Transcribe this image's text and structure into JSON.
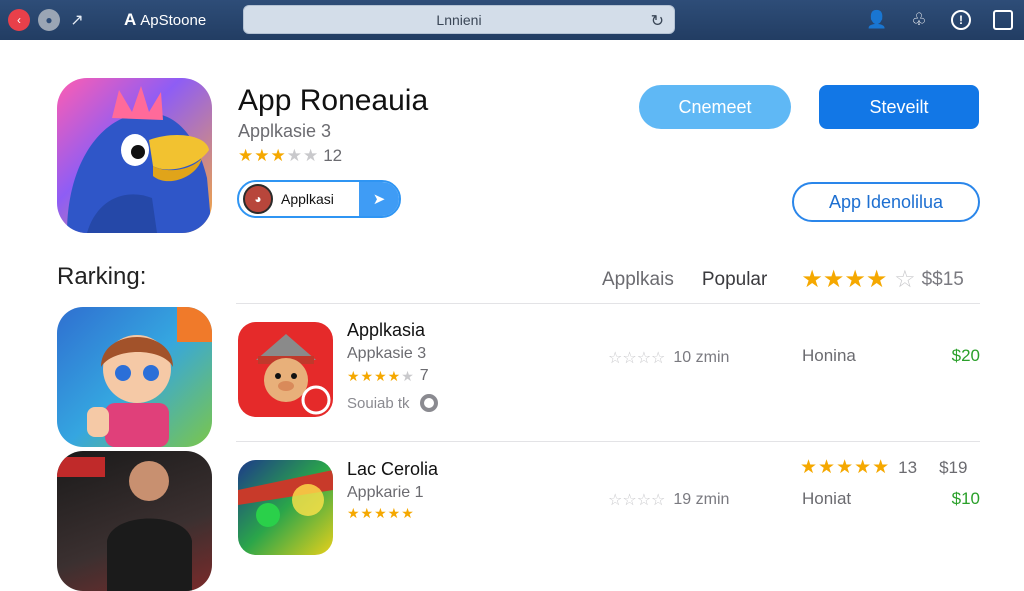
{
  "window": {
    "app_name": "ApStoone",
    "search_value": "Lnnieni"
  },
  "hero": {
    "title": "App Roneauia",
    "subtitle": "Applkasie 3",
    "rating_stars": 3,
    "rating_count": "12",
    "pill_label": "Applkasi",
    "buttons": {
      "primary_light": "Cnemeet",
      "primary": "Steveilt",
      "outline": "App Idenolilua"
    }
  },
  "ranking": {
    "title": "Rarking",
    "tabs": [
      "Applkais",
      "Popular"
    ],
    "header_stars": 4,
    "header_price": "$$15"
  },
  "items": [
    {
      "title": "Applkasia",
      "subtitle": "Appkasie 3",
      "stars": 4,
      "rating_count": "7",
      "extra": "Souiab tk",
      "meta_stars": 0,
      "meta_value": "10 zmin",
      "category": "Honina",
      "price": "$20"
    },
    {
      "title": "Lac Cerolia",
      "subtitle": "Appkarie 1",
      "stars": 5,
      "rating_count": "13",
      "top_price": "$19",
      "meta_stars": 0,
      "meta_value": "19 zmin",
      "category": "Honiat",
      "price": "$10"
    }
  ],
  "colors": {
    "titlebar": "#223d63",
    "accent": "#1277e6",
    "price_green": "#2aa02a",
    "star": "#f5a800"
  }
}
